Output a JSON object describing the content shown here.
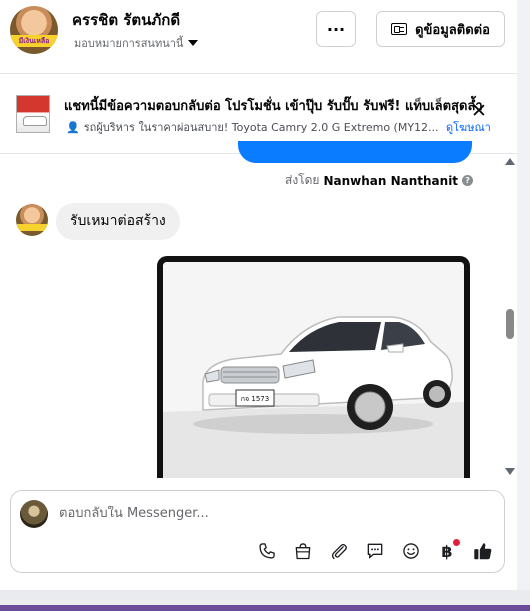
{
  "header": {
    "name": "ครรชิต รัตนภักดี",
    "subtitle": "มอบหมายการสนทนานี้",
    "avatar_tag": "มีเงินเหลือ",
    "more_button_label": "···",
    "contact_button_label": "ดูข้อมูลติดต่อ"
  },
  "ad": {
    "title": "แชทนี้มีข้อความตอบกลับต่อ โปรโมชั่น เข้าปุ๊บ รับปั๊บ รับฟรี! แท็บเล็ตสุดล้ำ",
    "subtitle": "รถผู้บริหาร ในราคาผ่อนสบาย! Toyota Camry 2.0 G Extremo (MY12...",
    "link": "ดูโฆษณา",
    "close": "✕"
  },
  "conversation": {
    "sent_by_prefix": "ส่งโดย",
    "sent_by_name": "Nanwhan Nanthanit",
    "received_message": "รับเหมาต่อสร้าง",
    "car_plate": "กจ 1573"
  },
  "composer": {
    "placeholder": "ตอบกลับใน Messenger..."
  },
  "icons": [
    "phone-icon",
    "bag-icon",
    "paperclip-icon",
    "chat-icon",
    "emoji-icon",
    "baht-icon",
    "like-icon"
  ],
  "colors": {
    "accent": "#0a7cff",
    "link": "#0866ff",
    "notification": "#e41e3f"
  }
}
